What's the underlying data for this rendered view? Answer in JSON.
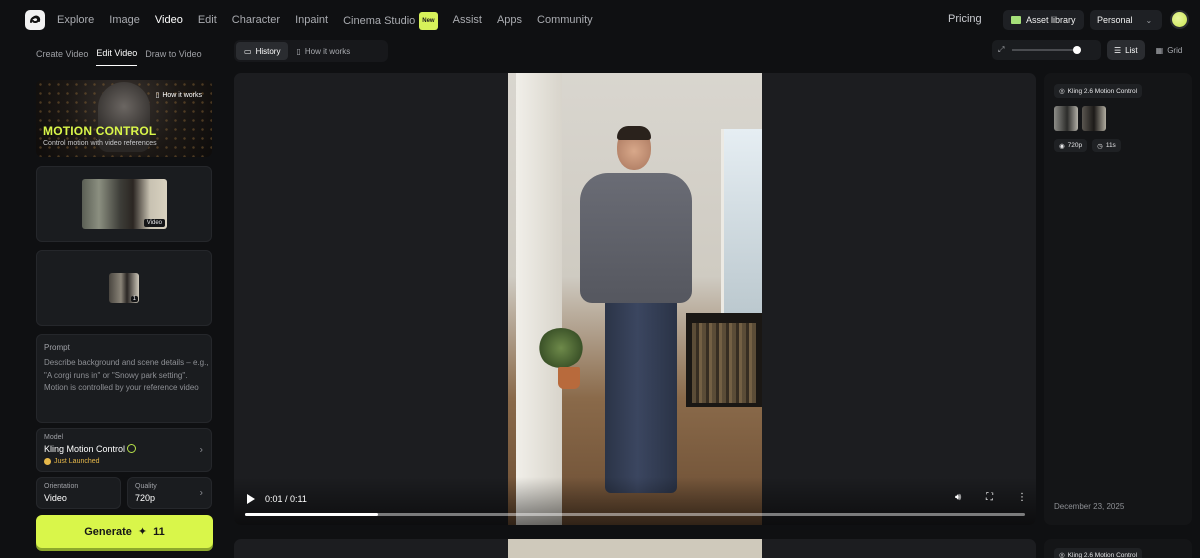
{
  "nav": {
    "items": [
      "Explore",
      "Image",
      "Video",
      "Edit",
      "Character",
      "Inpaint",
      "Cinema Studio",
      "Assist",
      "Apps",
      "Community"
    ],
    "active": "Video",
    "new_badge": "New",
    "pricing": "Pricing",
    "asset_library": "Asset library",
    "workspace": "Personal"
  },
  "left": {
    "tabs": [
      "Create Video",
      "Edit Video",
      "Draw to Video"
    ],
    "active_tab": "Edit Video",
    "hero": {
      "how_it_works": "How it works",
      "title": "MOTION CONTROL",
      "subtitle": "Control motion with video references"
    },
    "video_label": "Video",
    "ref_count": "1",
    "prompt": {
      "label": "Prompt",
      "placeholder": "Describe background and scene details – e.g., \"A corgi runs in\" or \"Snowy park setting\". Motion is controlled by your reference video"
    },
    "model": {
      "label": "Model",
      "value": "Kling Motion Control",
      "status": "Just Launched"
    },
    "orientation": {
      "label": "Orientation",
      "value": "Video"
    },
    "quality": {
      "label": "Quality",
      "value": "720p"
    },
    "generate": {
      "label": "Generate",
      "cost": "11"
    }
  },
  "toolbar": {
    "history": "History",
    "how_it_works": "How it works",
    "zoom_level": 1.0,
    "list": "List",
    "grid": "Grid"
  },
  "player": {
    "time": "0:01 / 0:11",
    "progress": 0.17
  },
  "side": {
    "model": "Kling 2.6 Motion Control",
    "resolution": "720p",
    "duration": "11s",
    "date": "December 23, 2025"
  },
  "colors": {
    "accent": "#d9f64a",
    "background": "#0f1012",
    "card": "#1a1c1f",
    "warning": "#e6b84a"
  }
}
